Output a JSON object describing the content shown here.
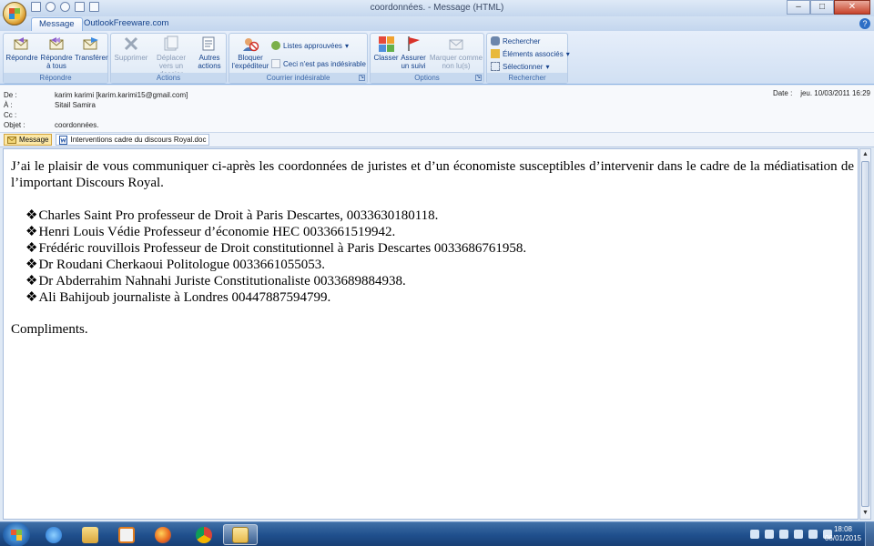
{
  "window": {
    "title": "coordonnées.  -  Message (HTML)",
    "minimize": "–",
    "maximize": "□",
    "close": "✕"
  },
  "tabs": [
    {
      "label": "Message"
    },
    {
      "label": "OutlookFreeware.com"
    }
  ],
  "help": "?",
  "ribbon": {
    "repondre": {
      "label": "Répondre",
      "buttons": [
        "Répondre",
        "Répondre à tous",
        "Transférer"
      ]
    },
    "actions": {
      "label": "Actions",
      "supprimer": "Supprimer",
      "deplacer": "Déplacer vers un dossier",
      "autres": "Autres actions"
    },
    "courrier": {
      "label": "Courrier indésirable",
      "bloquer": "Bloquer l'expéditeur",
      "listes": "Listes approuvées",
      "pas_indesirable": "Ceci n'est pas indésirable"
    },
    "options": {
      "label": "Options",
      "classer": "Classer",
      "assurer": "Assurer un suivi",
      "marquer": "Marquer comme non lu(s)"
    },
    "rechercher": {
      "label": "Rechercher",
      "rechercher": "Rechercher",
      "elements": "Éléments associés",
      "selectionner": "Sélectionner"
    }
  },
  "headers": {
    "de_label": "De :",
    "de_value": "karim karimi [karim.karimi15@gmail.com]",
    "a_label": "À :",
    "a_value": "Sitail Samira",
    "cc_label": "Cc :",
    "cc_value": "",
    "objet_label": "Objet :",
    "objet_value": "coordonnées.",
    "date_label": "Date :",
    "date_value": "jeu. 10/03/2011 16:29"
  },
  "attachments": [
    {
      "label": "Message",
      "icon": "envelope-icon"
    },
    {
      "label": "Interventions  cadre du discours Royal.doc",
      "icon": "word-doc-icon"
    }
  ],
  "body": {
    "paragraph": "J’ai le plaisir de vous communiquer ci-après les coordonnées de juristes et d’un économiste susceptibles d’intervenir dans le cadre de la médiatisation de l’important Discours Royal.",
    "bullet": "❖",
    "items": [
      "Charles Saint Pro professeur de Droit à Paris Descartes, 0033630180118.",
      "Henri Louis Védie Professeur d’économie HEC 0033661519942.",
      "Frédéric rouvillois Professeur de Droit constitutionnel à Paris Descartes 0033686761958.",
      "Dr Roudani Cherkaoui Politologue 0033661055053.",
      "Dr Abderrahim Nahnahi Juriste Constitutionaliste 0033689884938.",
      "Ali Bahijoub journaliste à Londres 00447887594799."
    ],
    "closing": "Compliments."
  },
  "taskbar": {
    "apps": [
      "file-explorer-icon",
      "internet-explorer-icon",
      "media-player-icon",
      "firefox-icon",
      "chrome-icon",
      "outlook-icon"
    ],
    "time": "18:08",
    "date": "06/01/2015"
  },
  "colors": {
    "ribbon_text": "#15428b",
    "taskbar": "#1f4f8c"
  }
}
